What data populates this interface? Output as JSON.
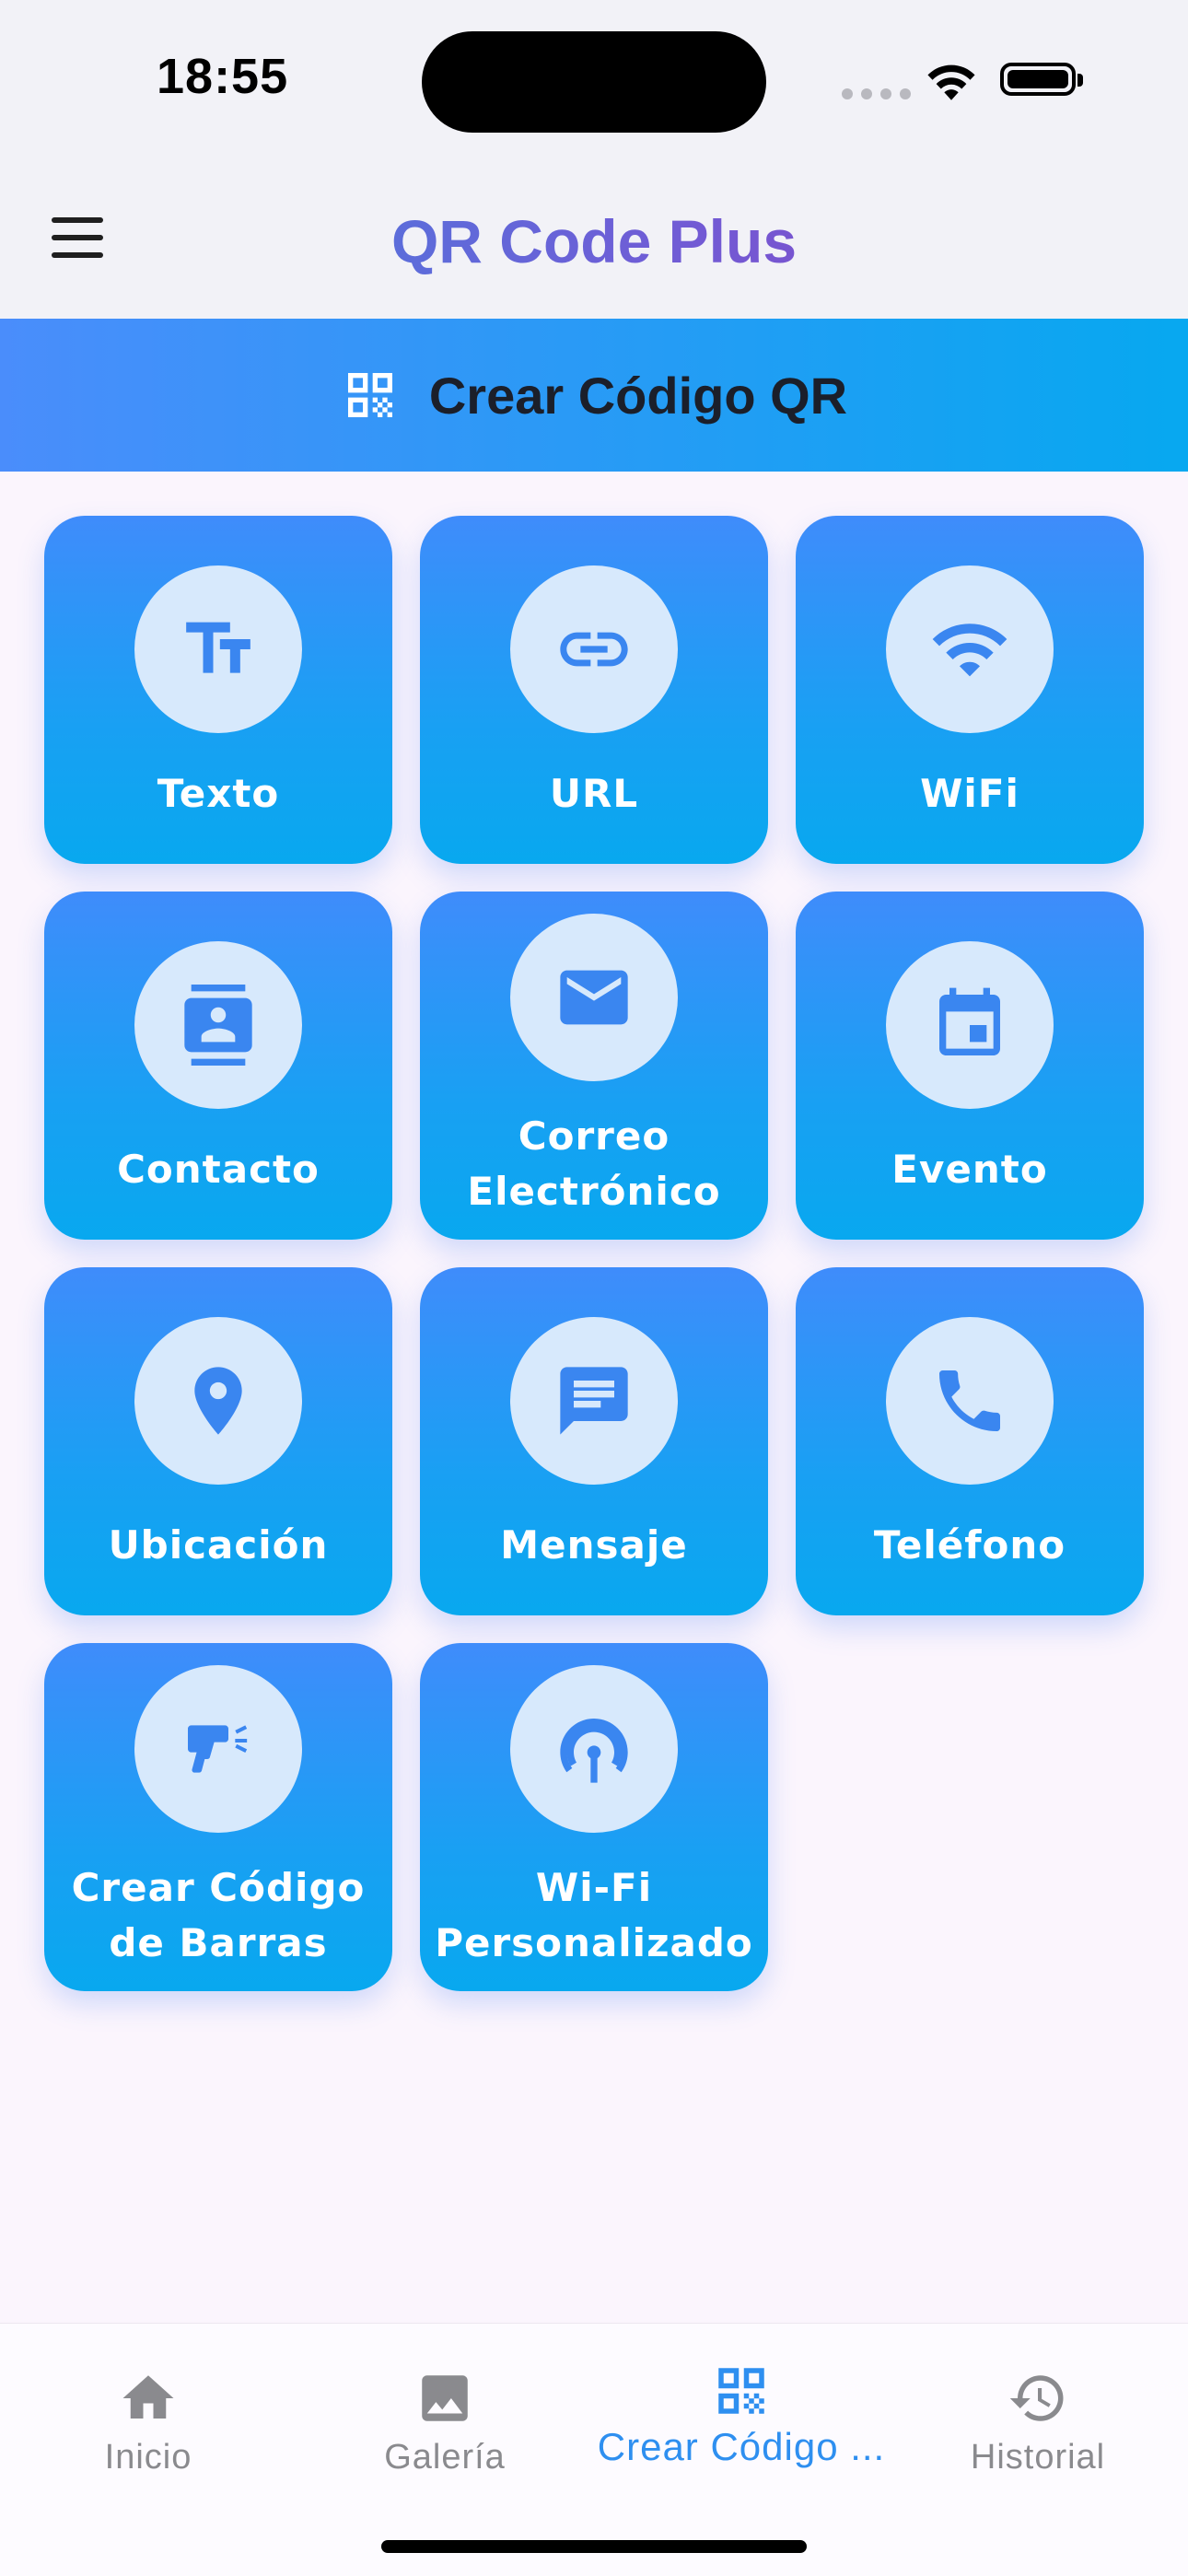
{
  "status_bar": {
    "time": "18:55"
  },
  "app_bar": {
    "title": "QR Code Plus"
  },
  "section": {
    "title": "Crear Código QR"
  },
  "tiles": [
    {
      "label": "Texto",
      "icon": "text-fields-icon"
    },
    {
      "label": "URL",
      "icon": "link-icon"
    },
    {
      "label": "WiFi",
      "icon": "wifi-icon"
    },
    {
      "label": "Contacto",
      "icon": "contact-card-icon"
    },
    {
      "label": "Correo Electrónico",
      "icon": "email-icon"
    },
    {
      "label": "Evento",
      "icon": "calendar-event-icon"
    },
    {
      "label": "Ubicación",
      "icon": "location-pin-icon"
    },
    {
      "label": "Mensaje",
      "icon": "message-icon"
    },
    {
      "label": "Teléfono",
      "icon": "phone-icon"
    },
    {
      "label": "Crear Código de Barras",
      "icon": "barcode-scanner-icon"
    },
    {
      "label": "Wi-Fi Personalizado",
      "icon": "wifi-tethering-icon"
    }
  ],
  "bottom_nav": [
    {
      "label": "Inicio",
      "icon": "home-icon"
    },
    {
      "label": "Galería",
      "icon": "gallery-icon"
    },
    {
      "label": "Crear Código ...",
      "icon": "qr-code-icon",
      "active": true
    },
    {
      "label": "Historial",
      "icon": "history-icon"
    }
  ],
  "colors": {
    "accent": "#2e8ff0",
    "tile_top": "#3f8cfb",
    "tile_bottom": "#08a8ef",
    "icon_bg": "#d7e9fc",
    "icon_fg": "#3a86f0"
  }
}
